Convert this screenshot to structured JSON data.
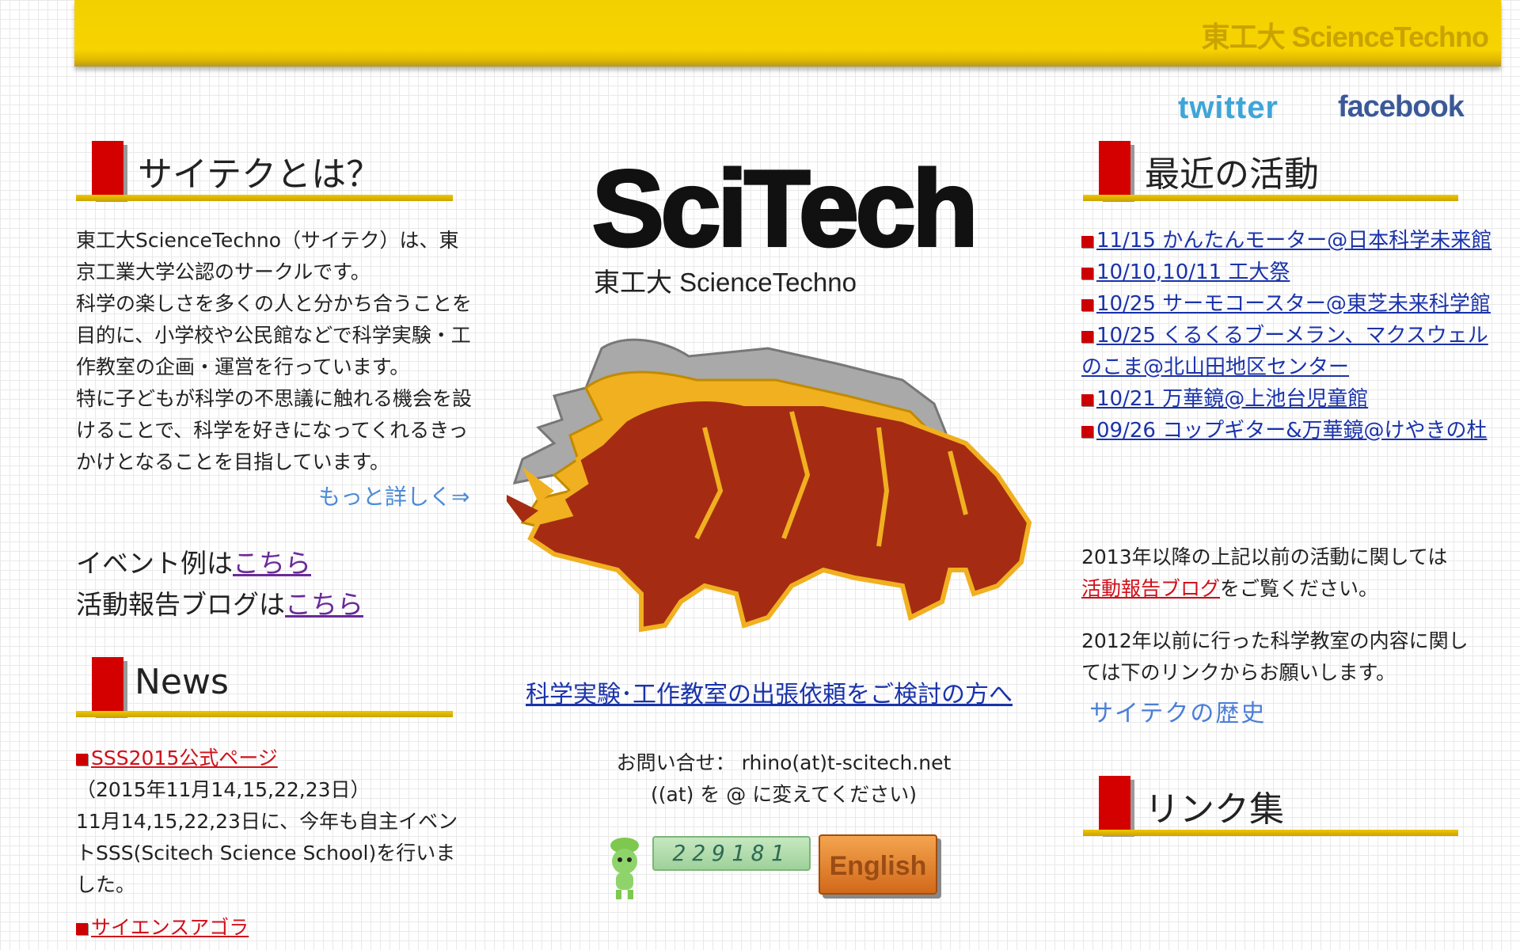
{
  "header": {
    "brand": "東工大 ScienceTechno"
  },
  "social": {
    "twitter": "twitter",
    "facebook": "facebook"
  },
  "about": {
    "heading": "サイテクとは？",
    "lines": [
      "東工大ScienceTechno（サイテク）は、東",
      "京工業大学公認のサークルです。",
      "科学の楽しさを多くの人と分かち合うことを",
      "目的に、小学校や公民館などで科学実験・工",
      "作教室の企画・運営を行っています。",
      "特に子どもが科学の不思議に触れる機会を設",
      "けることで、科学を好きになってくれるきっ",
      "かけとなることを目指しています。"
    ],
    "more_link": "もっと詳しく⇒",
    "event_prefix": "イベント例は",
    "event_link": "こちら",
    "blog_prefix": "活動報告ブログは",
    "blog_link": "こちら"
  },
  "news": {
    "heading": "News",
    "item1_link": "SSS2015公式ページ",
    "item1_lines": [
      "（2015年11月14,15,22,23日）",
      "11月14,15,22,23日に、今年も自主イベン",
      "トSSS(Scitech Science School)を行いま",
      "した。"
    ],
    "item2_link": "サイエンスアゴラ"
  },
  "logo": {
    "title": "SciTech",
    "subtitle": "東工大 ScienceTechno"
  },
  "center": {
    "request_link": "科学実験･工作教室の出張依頼をご検討の方へ",
    "contact_line1": "お問い合せ： rhino(at)t-scitech.net",
    "contact_line2": "((at) を @ に変えてください)",
    "counter": "229181",
    "english_button": "English"
  },
  "activities": {
    "heading": "最近の活動",
    "items": [
      "11/15 かんたんモーター@日本科学未来館",
      "10/10,10/11 工大祭",
      "10/25 サーモコースター@東芝未来科学館",
      "10/25 くるくるブーメラン、マクスウェルのこま@北山田地区センター",
      "10/21 万華鏡@上池台児童館",
      "09/26 コップギター&万華鏡@けやきの杜"
    ],
    "note1_line1": "2013年以降の上記以前の活動に関しては",
    "note1_link": "活動報告ブログ",
    "note1_suffix": "をご覧ください。",
    "note2_line1": "2012年以前に行った科学教室の内容に関し",
    "note2_line2": "ては下のリンクからお願いします。",
    "history_link": "サイテクの歴史"
  },
  "links": {
    "heading": "リンク集"
  },
  "colors": {
    "header_yellow": "#f7d400",
    "accent_red": "#d40000",
    "link_blue": "#1a33aa"
  }
}
